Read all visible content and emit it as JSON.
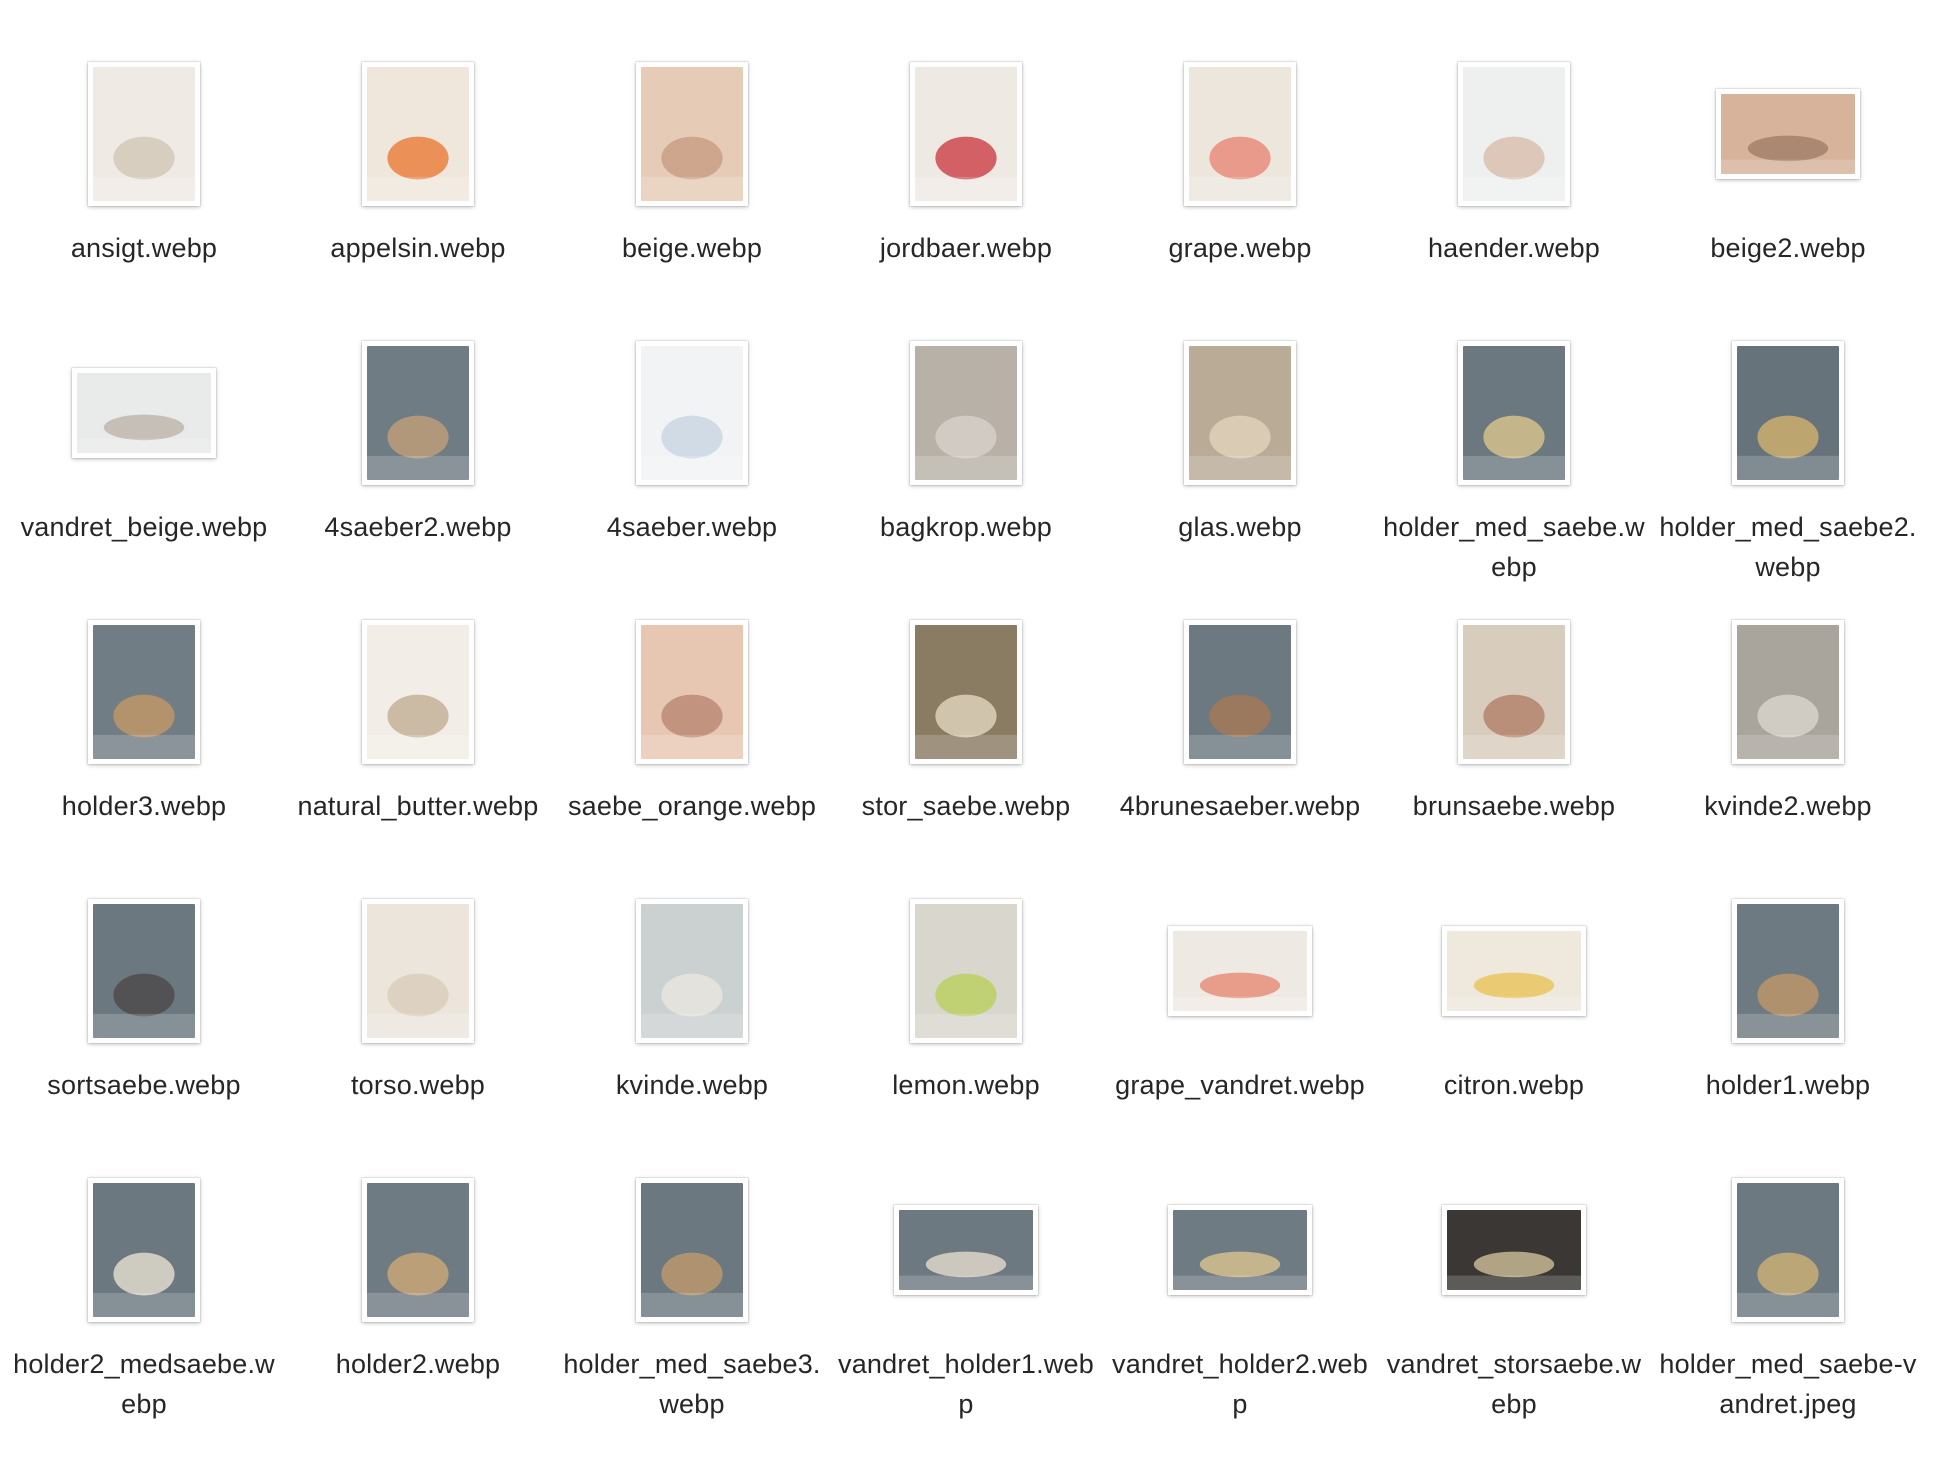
{
  "files": [
    {
      "name": "ansigt.webp",
      "orientation": "portrait",
      "colors": [
        "#efeae4",
        "#cfc4b4"
      ]
    },
    {
      "name": "appelsin.webp",
      "orientation": "portrait",
      "colors": [
        "#efe7dc",
        "#e9742c"
      ]
    },
    {
      "name": "beige.webp",
      "orientation": "portrait",
      "colors": [
        "#e6ccb6",
        "#c49a7f"
      ]
    },
    {
      "name": "jordbaer.webp",
      "orientation": "portrait",
      "colors": [
        "#efe9e4",
        "#c8313a"
      ]
    },
    {
      "name": "grape.webp",
      "orientation": "portrait",
      "colors": [
        "#ece6dd",
        "#e8806f"
      ]
    },
    {
      "name": "haender.webp",
      "orientation": "portrait",
      "colors": [
        "#eef0f0",
        "#d7b9a6"
      ]
    },
    {
      "name": "beige2.webp",
      "orientation": "landscape",
      "colors": [
        "#d6b39a",
        "#9c7a63"
      ]
    },
    {
      "name": "vandret_beige.webp",
      "orientation": "landscape",
      "colors": [
        "#e9eaea",
        "#b9b0a6"
      ]
    },
    {
      "name": "4saeber2.webp",
      "orientation": "portrait",
      "colors": [
        "#6f7c83",
        "#c7a178"
      ]
    },
    {
      "name": "4saeber.webp",
      "orientation": "portrait",
      "colors": [
        "#f2f3f5",
        "#c6d3e0"
      ]
    },
    {
      "name": "bagkrop.webp",
      "orientation": "portrait",
      "colors": [
        "#b7b1a8",
        "#d9d4cc"
      ]
    },
    {
      "name": "glas.webp",
      "orientation": "portrait",
      "colors": [
        "#b9ab96",
        "#e4d6be"
      ]
    },
    {
      "name": "holder_med_saebe.webp",
      "orientation": "portrait",
      "colors": [
        "#6b7880",
        "#e3c98e"
      ]
    },
    {
      "name": "holder_med_saebe2.webp",
      "orientation": "portrait",
      "colors": [
        "#66737b",
        "#d9b56b"
      ]
    },
    {
      "name": "holder3.webp",
      "orientation": "portrait",
      "colors": [
        "#717d84",
        "#c89b63"
      ]
    },
    {
      "name": "natural_butter.webp",
      "orientation": "portrait",
      "colors": [
        "#f2ede6",
        "#bda98e"
      ]
    },
    {
      "name": "saebe_orange.webp",
      "orientation": "portrait",
      "colors": [
        "#e8c7b2",
        "#b6826d"
      ]
    },
    {
      "name": "stor_saebe.webp",
      "orientation": "portrait",
      "colors": [
        "#8a7b63",
        "#e7dcc6"
      ]
    },
    {
      "name": "4brunesaeber.webp",
      "orientation": "portrait",
      "colors": [
        "#6c7980",
        "#a97954"
      ]
    },
    {
      "name": "brunsaebe.webp",
      "orientation": "portrait",
      "colors": [
        "#d8cdbd",
        "#b07a63"
      ]
    },
    {
      "name": "kvinde2.webp",
      "orientation": "portrait",
      "colors": [
        "#a9a49c",
        "#dedad2"
      ]
    },
    {
      "name": "sortsaebe.webp",
      "orientation": "portrait",
      "colors": [
        "#6b7880",
        "#4a4444"
      ]
    },
    {
      "name": "torso.webp",
      "orientation": "portrait",
      "colors": [
        "#ebe5dc",
        "#d8cbb8"
      ]
    },
    {
      "name": "kvinde.webp",
      "orientation": "portrait",
      "colors": [
        "#cbd0d0",
        "#ece8e2"
      ]
    },
    {
      "name": "lemon.webp",
      "orientation": "portrait",
      "colors": [
        "#d9d6cd",
        "#b7cf55"
      ]
    },
    {
      "name": "grape_vandret.webp",
      "orientation": "landscape",
      "colors": [
        "#efe9e3",
        "#e6836e"
      ]
    },
    {
      "name": "citron.webp",
      "orientation": "landscape",
      "colors": [
        "#eee8dd",
        "#e8c24f"
      ]
    },
    {
      "name": "holder1.webp",
      "orientation": "portrait",
      "colors": [
        "#6e7a81",
        "#c59a67"
      ]
    },
    {
      "name": "holder2_medsaebe.webp",
      "orientation": "portrait",
      "colors": [
        "#6b7880",
        "#efe7d6"
      ]
    },
    {
      "name": "holder2.webp",
      "orientation": "portrait",
      "colors": [
        "#6f7b82",
        "#d4ab76"
      ]
    },
    {
      "name": "holder_med_saebe3.webp",
      "orientation": "portrait",
      "colors": [
        "#6b7880",
        "#c69c6b"
      ]
    },
    {
      "name": "vandret_holder1.webp",
      "orientation": "landscape",
      "colors": [
        "#6d7980",
        "#ece3d2"
      ]
    },
    {
      "name": "vandret_holder2.webp",
      "orientation": "landscape",
      "colors": [
        "#6f7b82",
        "#e2c88f"
      ]
    },
    {
      "name": "vandret_storsaebe.webp",
      "orientation": "landscape",
      "colors": [
        "#3a3734",
        "#d9c99f"
      ]
    },
    {
      "name": "holder_med_saebe-vandret.jpeg",
      "orientation": "portrait",
      "colors": [
        "#6c7980",
        "#d6b675"
      ]
    }
  ]
}
